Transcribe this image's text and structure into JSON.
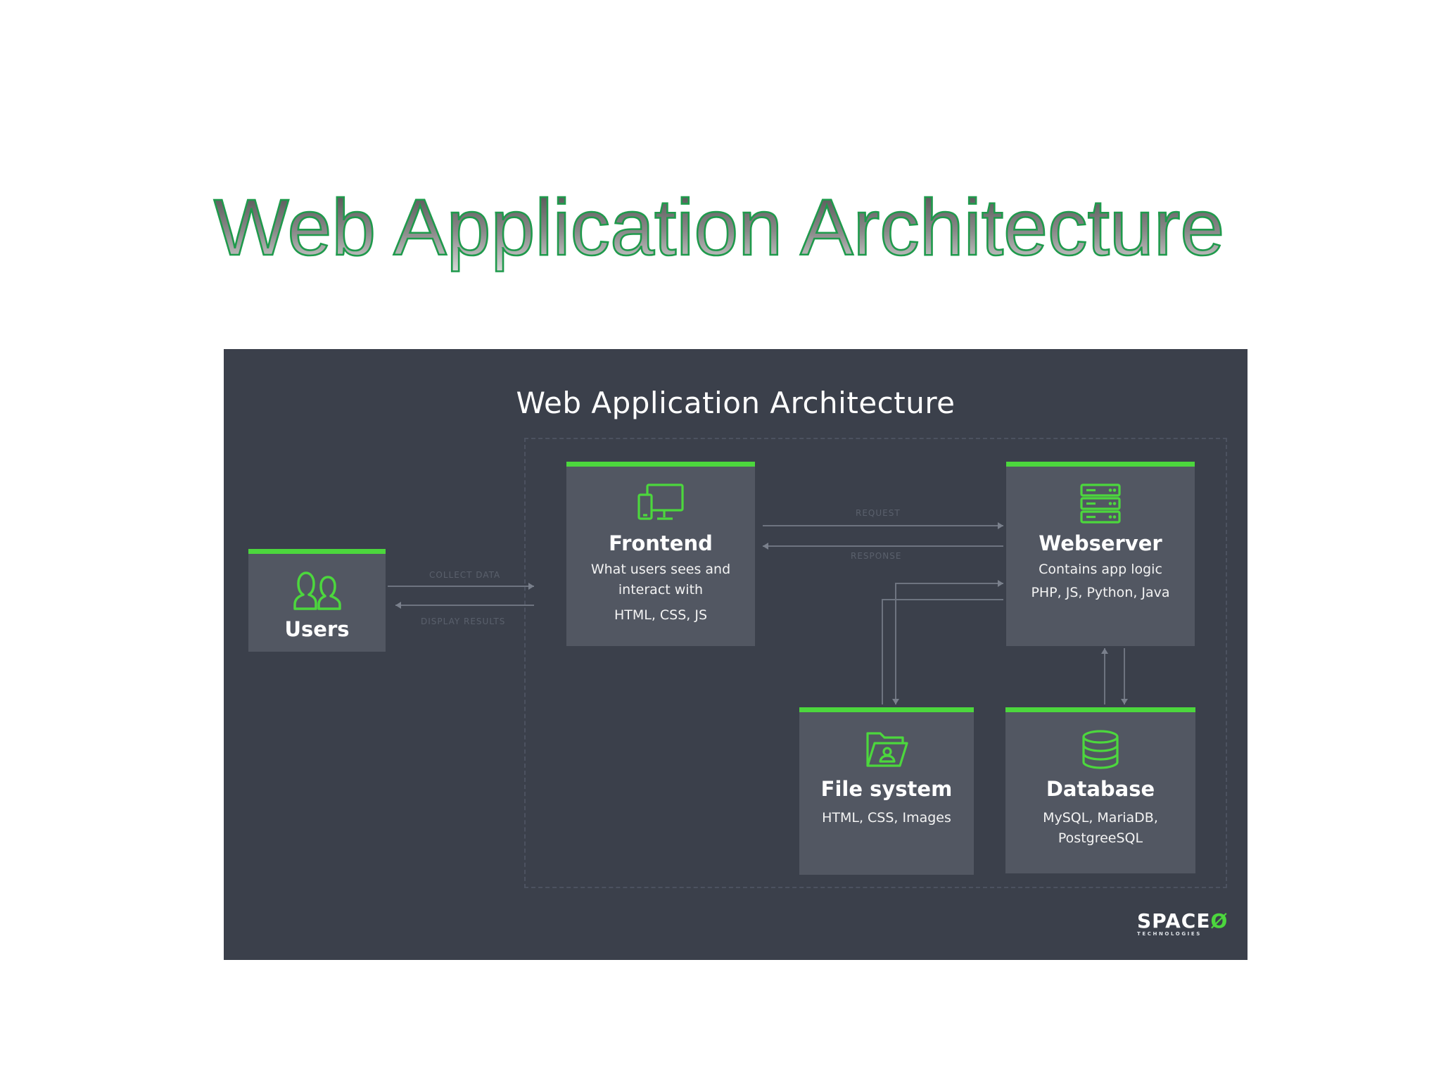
{
  "slide": {
    "title": "Web Application Architecture"
  },
  "diagram": {
    "title": "Web Application Architecture",
    "accent_color": "#4cd73d",
    "panel_color": "#3b404b",
    "card_color": "#525762",
    "nodes": {
      "users": {
        "name": "Users",
        "icon": "users-icon"
      },
      "frontend": {
        "name": "Frontend",
        "icon": "devices-icon",
        "desc_1": "What users sees and",
        "desc_2": "interact with",
        "desc_3": "HTML, CSS, JS"
      },
      "webserver": {
        "name": "Webserver",
        "icon": "server-icon",
        "desc_1": "Contains app logic",
        "desc_2": "PHP, JS, Python, Java"
      },
      "filesystem": {
        "name": "File system",
        "icon": "folder-user-icon",
        "desc_1": "HTML, CSS, Images"
      },
      "database": {
        "name": "Database",
        "icon": "database-icon",
        "desc_1": "MySQL, MariaDB,",
        "desc_2": "PostgreeSQL"
      }
    },
    "edges": {
      "collect_data": "COLLECT DATA",
      "display_results": "DISPLAY RESULTS",
      "request": "REQUEST",
      "response": "RESPONSE"
    },
    "logo": {
      "main_left": "SPACE",
      "main_mark": "Ø",
      "sub": "TECHNOLOGIES"
    }
  }
}
